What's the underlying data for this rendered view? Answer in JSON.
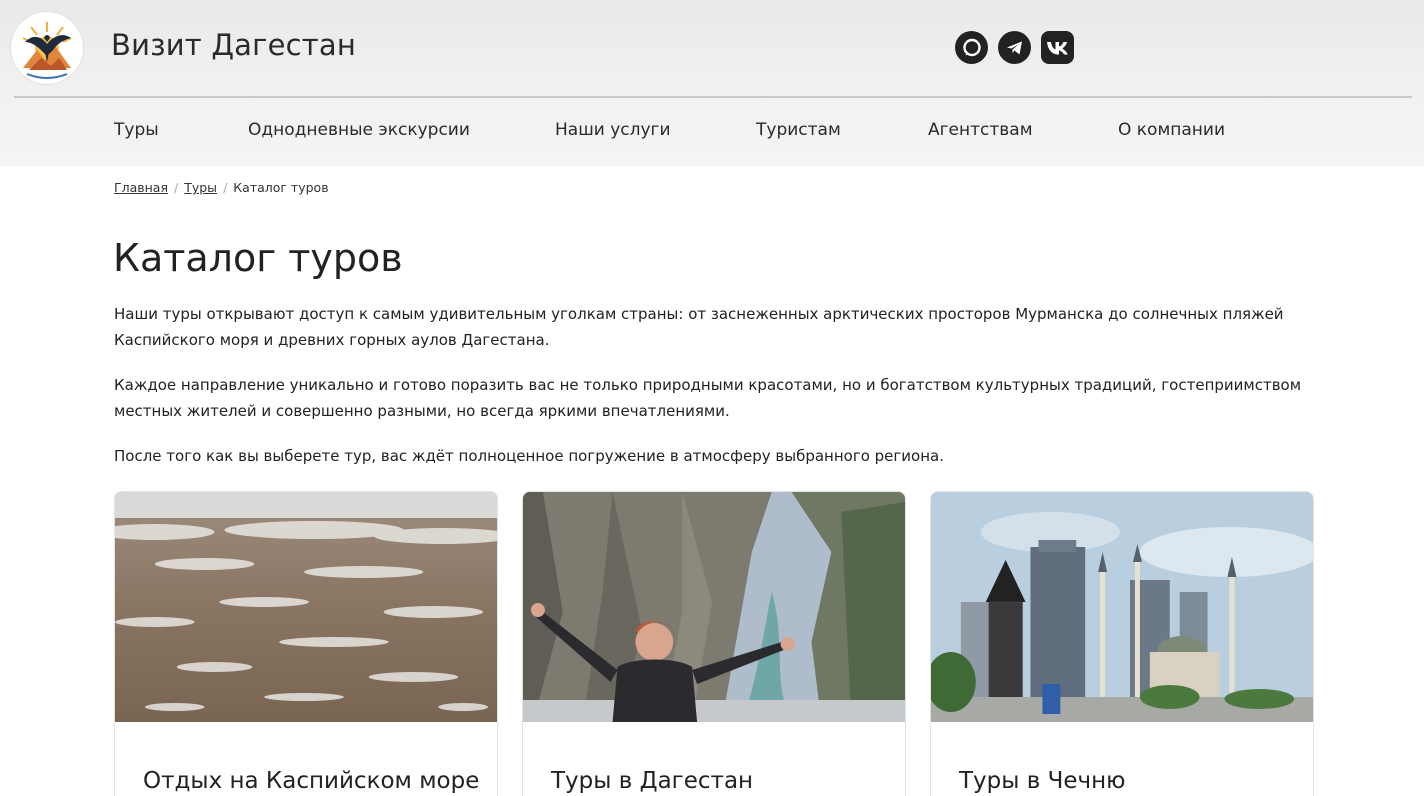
{
  "header": {
    "site_title": "Визит Дагестан",
    "social": [
      {
        "icon": "whatsapp-icon"
      },
      {
        "icon": "telegram-icon"
      },
      {
        "icon": "vk-icon"
      }
    ]
  },
  "nav": {
    "items": [
      "Туры",
      "Однодневные экскурсии",
      "Наши услуги",
      "Туристам",
      "Агентствам",
      "О компании"
    ]
  },
  "breadcrumb": {
    "home": "Главная",
    "tours": "Туры",
    "current": "Каталог туров",
    "separator": "/"
  },
  "main": {
    "title": "Каталог туров",
    "paragraphs": [
      "Наши туры открывают доступ к самым удивительным уголкам страны: от заснеженных арктических просторов Мурманска до солнечных пляжей Каспийского моря и древних горных аулов Дагестана.",
      "Каждое направление уникально и готово поразить вас не только природными красотами, но и богатством культурных традиций, гостеприимством местных жителей и совершенно разными, но всегда яркими впечатлениями.",
      "После того как вы выберете тур, вас ждёт полноценное погружение в атмосферу выбранного региона."
    ]
  },
  "cards": [
    {
      "title": "Отдых на Каспийском море"
    },
    {
      "title": "Туры в Дагестан"
    },
    {
      "title": "Туры в Чечню"
    }
  ],
  "colors": {
    "header_bg": "#efeff0",
    "text": "#222222",
    "divider": "#c8c8ca"
  }
}
